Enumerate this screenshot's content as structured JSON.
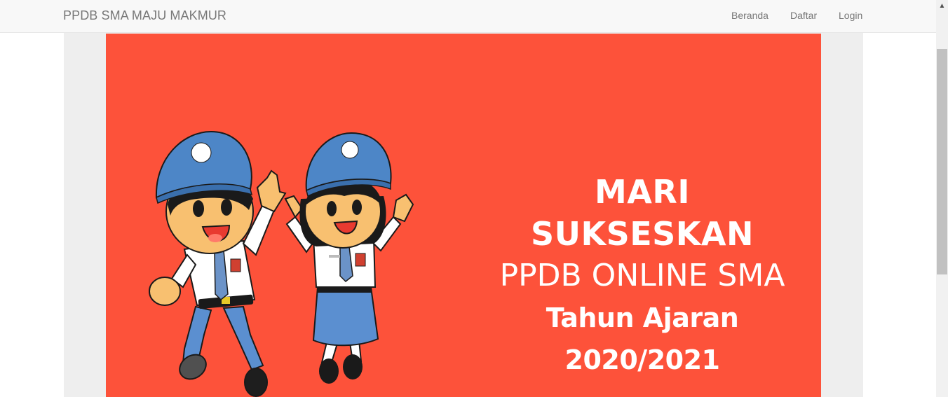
{
  "navbar": {
    "brand": "PPDB SMA MAJU MAKMUR",
    "links": [
      "Beranda",
      "Daftar",
      "Login"
    ]
  },
  "banner": {
    "line1": "MARI SUKSESKAN",
    "line2": "PPDB ONLINE SMA",
    "line3": "Tahun Ajaran 2020/2021",
    "background_color": "#fd523a"
  },
  "scrollbar": {
    "up_icon": "scroll-up-arrow-icon"
  }
}
